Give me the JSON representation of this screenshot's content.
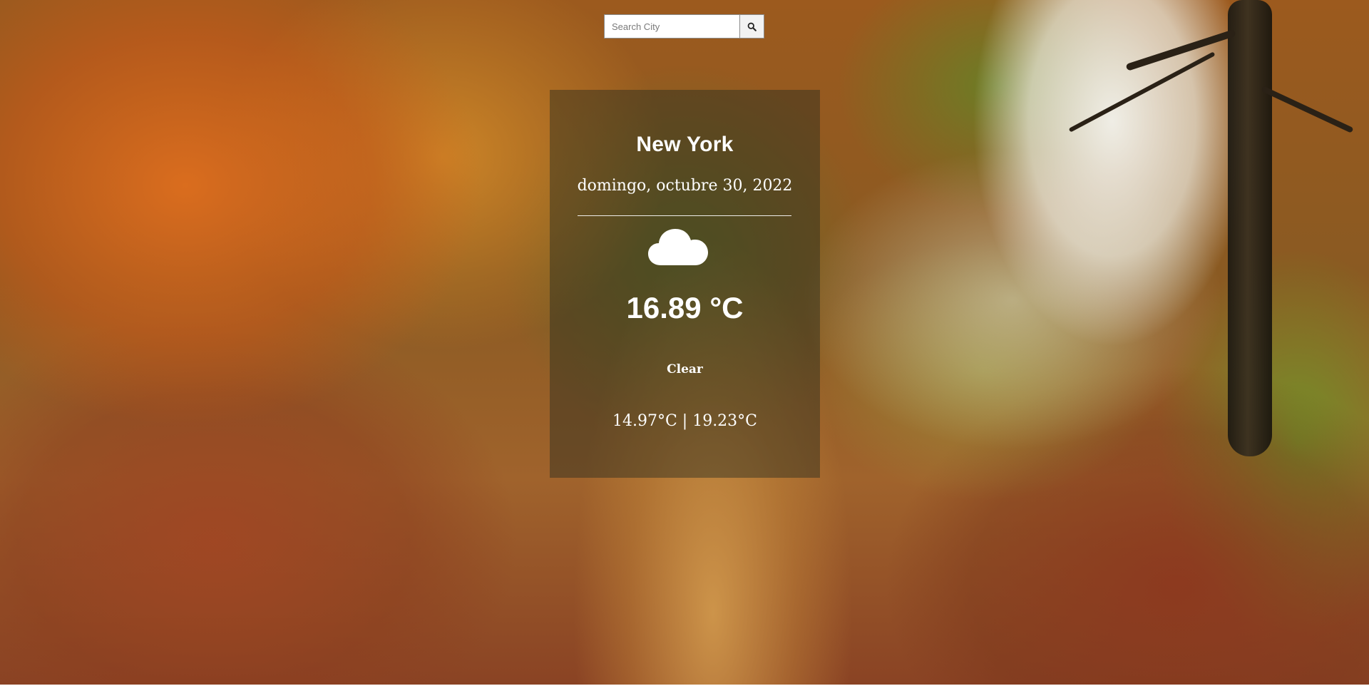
{
  "search": {
    "placeholder": "Search City",
    "value": "",
    "button_icon": "search-icon"
  },
  "weather": {
    "city": "New York",
    "date": "domingo, octubre 30, 2022",
    "icon": "cloud-icon",
    "temperature": "16.89 °C",
    "description": "Clear",
    "min_max": "14.97°C | 19.23°C"
  },
  "colors": {
    "card_overlay": "#282d1e",
    "text": "#ffffff"
  }
}
